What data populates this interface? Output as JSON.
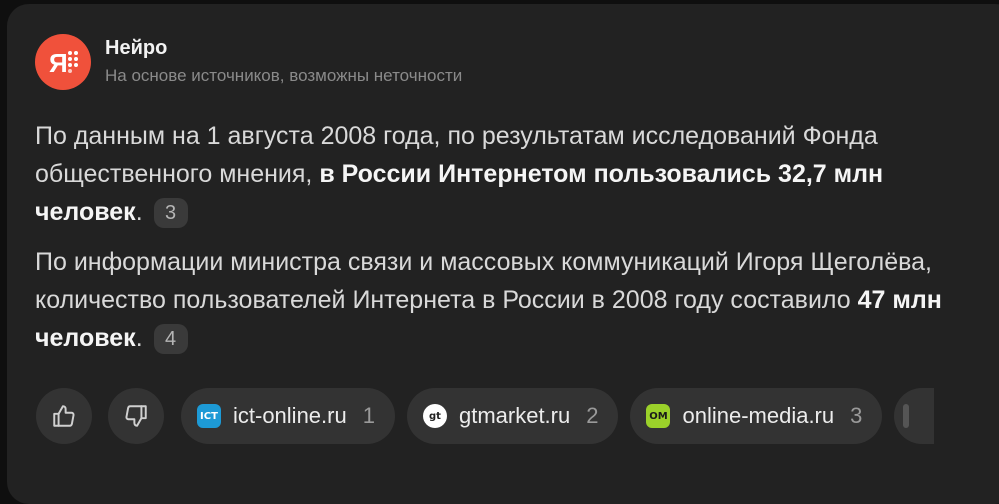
{
  "header": {
    "app_name": "Нейро",
    "subtitle": "На основе источников, возможны неточности",
    "logo_icon": "yandex-neuro-logo",
    "logo_color": "#f0513b"
  },
  "answer": {
    "p1_text_1": "По данным на 1 августа 2008 года, по результатам исследований Фонда общественного мнения, ",
    "p1_bold": "в России Интернетом пользовались 32,7 млн человек",
    "p1_end": ".",
    "p1_ref": "3",
    "p2_text_1": "По информации министра связи и массовых коммуникаций Игоря Щеголёва, количество пользователей Интернета в России в 2008 году составило ",
    "p2_bold": "47 млн человек",
    "p2_end": ".",
    "p2_ref": "4"
  },
  "footer": {
    "like_icon": "thumbs-up-icon",
    "dislike_icon": "thumbs-down-icon",
    "sources": [
      {
        "favicon": "ICT",
        "domain": "ict-online.ru",
        "num": "1"
      },
      {
        "favicon": "gt",
        "domain": "gtmarket.ru",
        "num": "2"
      },
      {
        "favicon": "OM",
        "domain": "online-media.ru",
        "num": "3"
      }
    ]
  }
}
